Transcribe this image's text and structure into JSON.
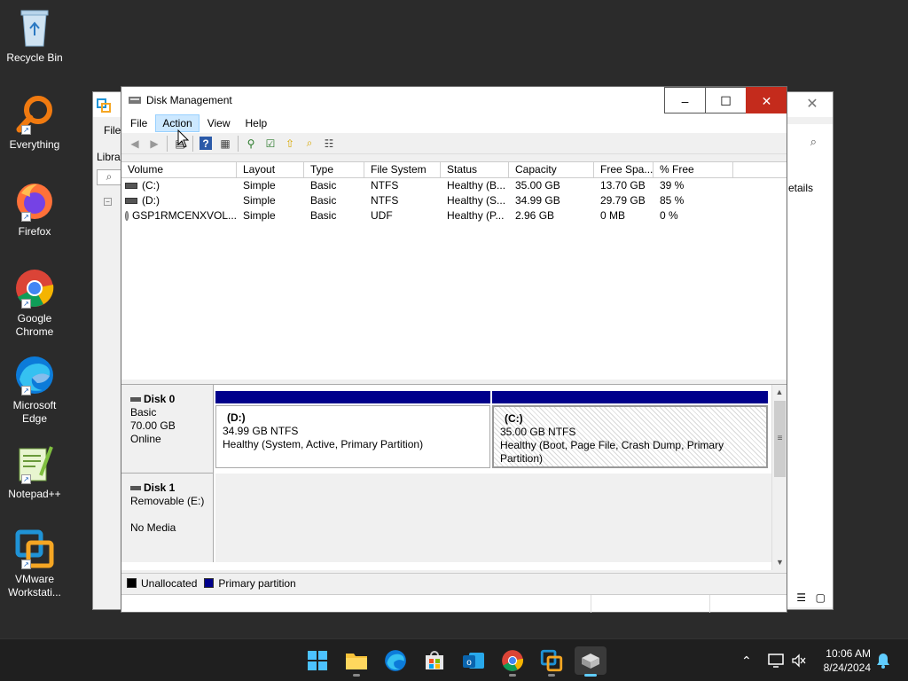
{
  "desktop": {
    "icons": [
      {
        "label": "Recycle Bin"
      },
      {
        "label": "Everything"
      },
      {
        "label": "Firefox"
      },
      {
        "label": "Google Chrome"
      },
      {
        "label": "Microsoft Edge"
      },
      {
        "label": "Notepad++"
      },
      {
        "label": "VMware Workstati..."
      }
    ]
  },
  "background_window": {
    "menu_file": "File",
    "lib_stub": "Libra",
    "details": "etails"
  },
  "window": {
    "title": "Disk Management",
    "menu": [
      "File",
      "Action",
      "View",
      "Help"
    ],
    "active_menu": "Action"
  },
  "volume_table": {
    "headers": [
      "Volume",
      "Layout",
      "Type",
      "File System",
      "Status",
      "Capacity",
      "Free Spa...",
      "% Free"
    ],
    "rows": [
      {
        "volume": "(C:)",
        "layout": "Simple",
        "type": "Basic",
        "fs": "NTFS",
        "status": "Healthy (B...",
        "capacity": "35.00 GB",
        "free": "13.70 GB",
        "pct": "39 %"
      },
      {
        "volume": "(D:)",
        "layout": "Simple",
        "type": "Basic",
        "fs": "NTFS",
        "status": "Healthy (S...",
        "capacity": "34.99 GB",
        "free": "29.79 GB",
        "pct": "85 %"
      },
      {
        "volume": "GSP1RMCENXVOL...",
        "layout": "Simple",
        "type": "Basic",
        "fs": "UDF",
        "status": "Healthy (P...",
        "capacity": "2.96 GB",
        "free": "0 MB",
        "pct": "0 %"
      }
    ]
  },
  "disks": [
    {
      "name": "Disk 0",
      "line1": "Basic",
      "line2": "70.00 GB",
      "line3": "Online",
      "partitions": [
        {
          "name": "(D:)",
          "size": "34.99 GB NTFS",
          "status": "Healthy (System, Active, Primary Partition)"
        },
        {
          "name": "(C:)",
          "size": "35.00 GB NTFS",
          "status": "Healthy (Boot, Page File, Crash Dump, Primary Partition)"
        }
      ]
    },
    {
      "name": "Disk 1",
      "line1": "Removable (E:)",
      "line2": "",
      "line3": "No Media"
    }
  ],
  "legend": {
    "items": [
      {
        "label": "Unallocated",
        "color": "#000000"
      },
      {
        "label": "Primary partition",
        "color": "#00008b"
      }
    ]
  },
  "clock": {
    "time": "10:06 AM",
    "date": "8/24/2024"
  },
  "colors": {
    "primary_partition": "#00008b",
    "close_button": "#c42b1c",
    "menu_highlight": "#cce8ff"
  }
}
